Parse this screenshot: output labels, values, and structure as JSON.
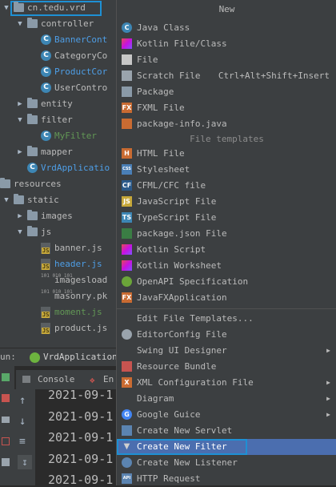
{
  "project_tree": {
    "items": [
      {
        "label": "cn.tedu.vrd",
        "type": "folder",
        "expanded": true,
        "indent": 0
      },
      {
        "label": "controller",
        "type": "folder",
        "expanded": true,
        "indent": 1
      },
      {
        "label": "BannerCont",
        "type": "class",
        "indent": 2,
        "color": "#4e9ee6"
      },
      {
        "label": "CategoryCo",
        "type": "class",
        "indent": 2,
        "color": "#bbbbbb"
      },
      {
        "label": "ProductCor",
        "type": "class",
        "indent": 2,
        "color": "#4e9ee6"
      },
      {
        "label": "UserContro",
        "type": "class",
        "indent": 2,
        "color": "#bbbbbb"
      },
      {
        "label": "entity",
        "type": "folder",
        "expanded": false,
        "indent": 1
      },
      {
        "label": "filter",
        "type": "folder",
        "expanded": true,
        "indent": 1
      },
      {
        "label": "MyFilter",
        "type": "class",
        "indent": 2,
        "color": "#629755"
      },
      {
        "label": "mapper",
        "type": "folder",
        "expanded": false,
        "indent": 1
      },
      {
        "label": "VrdApplicatio",
        "type": "class",
        "indent": 1,
        "color": "#4e9ee6"
      },
      {
        "label": "resources",
        "type": "folder",
        "expanded": true,
        "indent": -1
      },
      {
        "label": "static",
        "type": "folder",
        "expanded": true,
        "indent": 0
      },
      {
        "label": "images",
        "type": "folder",
        "expanded": false,
        "indent": 1
      },
      {
        "label": "js",
        "type": "folder",
        "expanded": true,
        "indent": 1
      },
      {
        "label": "banner.js",
        "type": "js",
        "indent": 2,
        "color": "#bbbbbb"
      },
      {
        "label": "header.js",
        "type": "js",
        "indent": 2,
        "color": "#4e9ee6"
      },
      {
        "label": "imagesload",
        "type": "bin",
        "indent": 2,
        "color": "#bbbbbb"
      },
      {
        "label": "masonry.pk",
        "type": "bin",
        "indent": 2,
        "color": "#bbbbbb"
      },
      {
        "label": "moment.js",
        "type": "js",
        "indent": 2,
        "color": "#629755"
      },
      {
        "label": "product.js",
        "type": "js",
        "indent": 2,
        "color": "#bbbbbb"
      }
    ]
  },
  "run_bar": {
    "prefix": "un:",
    "app_label": "VrdApplication"
  },
  "console_tabs": {
    "console": "Console",
    "endpoints": "En"
  },
  "console_lines": [
    "2021-09-1",
    "2021-09-1",
    "2021-09-1",
    "2021-09-1",
    "2021-09-1"
  ],
  "menu": {
    "title": "New",
    "section_file_templates": "File templates",
    "items_top": [
      {
        "label": "Java Class",
        "icon": "java-class-icon"
      },
      {
        "label": "Kotlin File/Class",
        "icon": "kotlin-icon"
      },
      {
        "label": "File",
        "icon": "file-icon"
      },
      {
        "label": "Scratch File",
        "icon": "scratch-file-icon",
        "shortcut": "Ctrl+Alt+Shift+Insert"
      },
      {
        "label": "Package",
        "icon": "package-icon"
      },
      {
        "label": "FXML File",
        "icon": "fxml-icon"
      },
      {
        "label": "package-info.java",
        "icon": "package-info-icon"
      }
    ],
    "items_templates": [
      {
        "label": "HTML File",
        "icon": "html-icon"
      },
      {
        "label": "Stylesheet",
        "icon": "css-icon"
      },
      {
        "label": "CFML/CFC file",
        "icon": "cfml-icon"
      },
      {
        "label": "JavaScript File",
        "icon": "javascript-icon"
      },
      {
        "label": "TypeScript File",
        "icon": "typescript-icon"
      },
      {
        "label": "package.json File",
        "icon": "package-json-icon"
      },
      {
        "label": "Kotlin Script",
        "icon": "kotlin-script-icon"
      },
      {
        "label": "Kotlin Worksheet",
        "icon": "kotlin-worksheet-icon"
      },
      {
        "label": "OpenAPI Specification",
        "icon": "openapi-icon"
      },
      {
        "label": "JavaFXApplication",
        "icon": "javafx-icon"
      }
    ],
    "items_bottom": [
      {
        "label": "Edit File Templates...",
        "icon": "",
        "submenu": false
      },
      {
        "label": "EditorConfig File",
        "icon": "gear-icon",
        "submenu": false
      },
      {
        "label": "Swing UI Designer",
        "icon": "",
        "submenu": true
      },
      {
        "label": "Resource Bundle",
        "icon": "resource-bundle-icon",
        "submenu": false
      },
      {
        "label": "XML Configuration File",
        "icon": "xml-icon",
        "submenu": true
      },
      {
        "label": "Diagram",
        "icon": "",
        "submenu": true
      },
      {
        "label": "Google Guice",
        "icon": "google-icon",
        "submenu": true
      },
      {
        "label": "Create New Servlet",
        "icon": "servlet-icon",
        "submenu": false
      },
      {
        "label": "Create New Filter",
        "icon": "filter-icon",
        "submenu": false,
        "highlighted": true
      },
      {
        "label": "Create New Listener",
        "icon": "listener-icon",
        "submenu": false
      },
      {
        "label": "HTTP Request",
        "icon": "api-icon",
        "submenu": false
      }
    ]
  },
  "colors": {
    "accent": "#4b6eaf",
    "selection_border": "#1e90d4",
    "panel": "#3c3f41",
    "editor": "#2b2b2b"
  }
}
